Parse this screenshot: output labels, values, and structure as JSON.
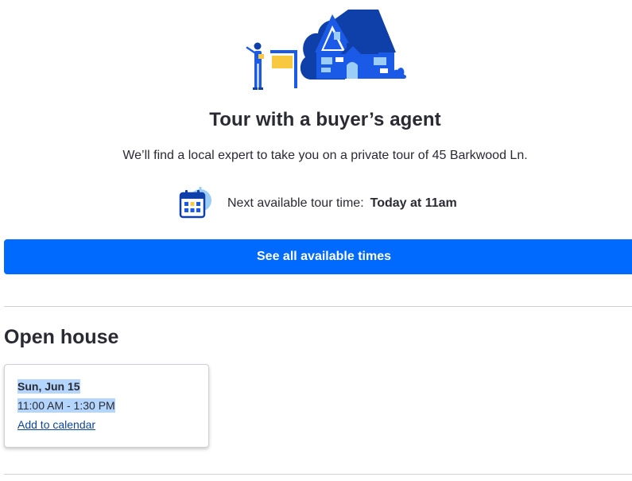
{
  "tour": {
    "title": "Tour with a buyer’s agent",
    "subtitle": "We’ll find a local expert to take you on a private tour of 45 Barkwood Ln.",
    "next_label": "Next available tour time:",
    "next_value": "Today at 11am",
    "see_all_label": "See all available times",
    "illustration_icon": "house-agent-illustration",
    "calendar_icon": "calendar-icon"
  },
  "open_house": {
    "title": "Open house",
    "events": [
      {
        "date": "Sun, Jun 15",
        "time": "11:00 AM - 1:30 PM",
        "link_label": "Add to calendar"
      }
    ]
  },
  "colors": {
    "primary_button": "#006aff",
    "text": "#2a2a33",
    "link": "#0d4599",
    "selection_highlight": "#b4d5fe",
    "illustration_dark_blue": "#0f3fa8",
    "illustration_blue": "#1a5ae6",
    "illustration_light_blue": "#9ccdf6",
    "illustration_yellow": "#f8c840"
  }
}
